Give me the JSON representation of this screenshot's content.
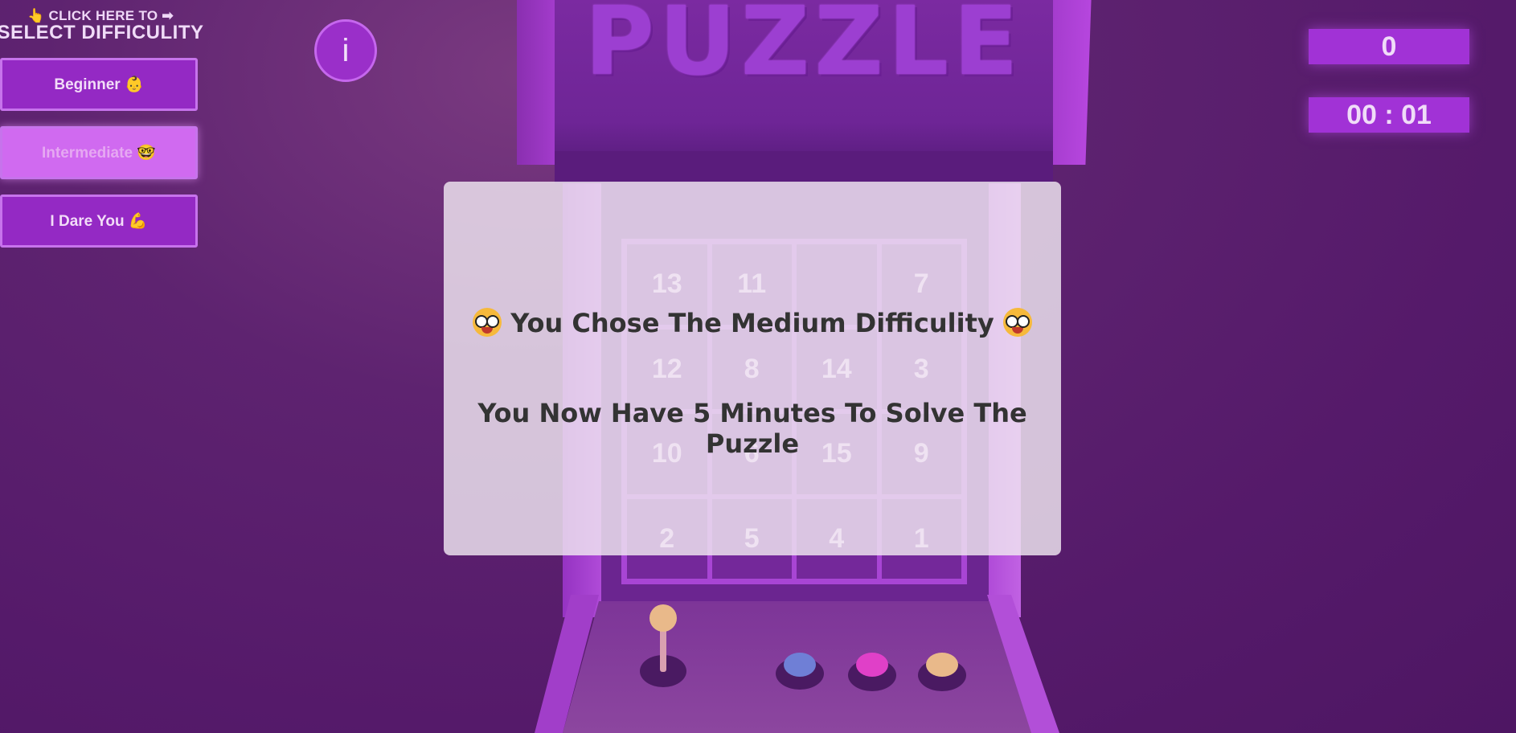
{
  "header": {
    "hint_line": "👆 CLICK HERE TO ➡",
    "hint_title": "SELECT DIFFICULITY",
    "info_label": "i"
  },
  "difficulty_buttons": [
    {
      "label": "Beginner 👶",
      "active": false
    },
    {
      "label": "Intermediate 🤓",
      "active": true
    },
    {
      "label": "I Dare You 💪",
      "active": false
    }
  ],
  "stats": {
    "moves": "0",
    "timer": "00 : 01"
  },
  "cabinet": {
    "title": "PUZZLE"
  },
  "puzzle": {
    "tiles": [
      "13",
      "11",
      "",
      "7",
      "12",
      "8",
      "14",
      "3",
      "10",
      "6",
      "15",
      "9",
      "2",
      "5",
      "4",
      "1"
    ]
  },
  "controls": {
    "button_colors": [
      "#6f7fd6",
      "#e040c8",
      "#e9b98a"
    ],
    "joystick_color": "#e9b98a"
  },
  "modal": {
    "line1": "You Chose The Medium Difficulity",
    "line2": "You Now Have 5 Minutes To Solve The Puzzle"
  }
}
